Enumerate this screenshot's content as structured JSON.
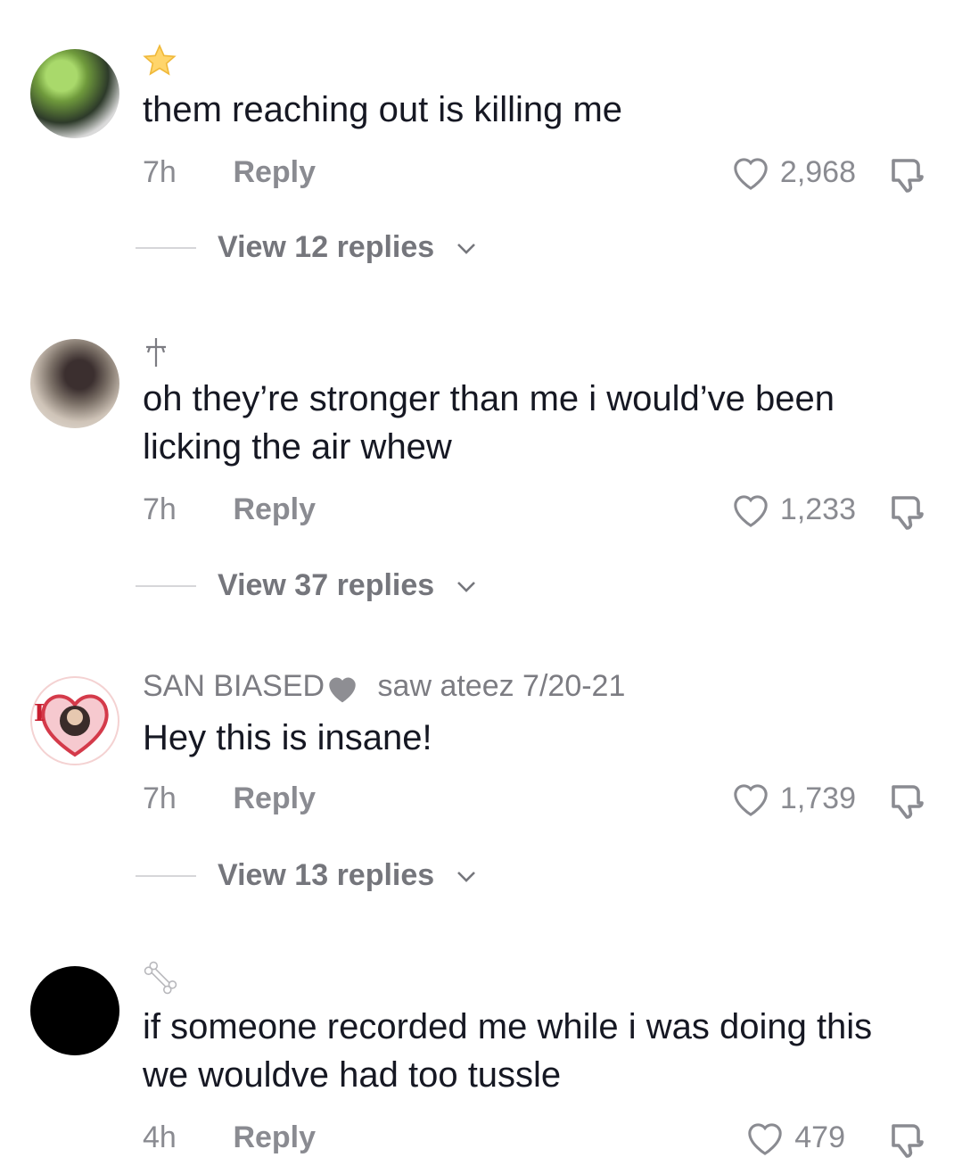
{
  "comments": [
    {
      "username": "",
      "emoji": "⭐",
      "text": "them reaching out is killing me",
      "time": "7h",
      "reply_label": "Reply",
      "likes": "2,968",
      "view_replies": "View 12 replies"
    },
    {
      "username": "",
      "emoji": "☩",
      "text": "oh they’re stronger than me i would’ve been licking the air whew",
      "time": "7h",
      "reply_label": "Reply",
      "likes": "1,233",
      "view_replies": "View 37 replies"
    },
    {
      "username": "SAN BIASED",
      "username_suffix": "saw ateez 7/20-21",
      "text": "Hey this is insane!",
      "time": "7h",
      "reply_label": "Reply",
      "likes": "1,739",
      "view_replies": "View 13 replies"
    },
    {
      "username": "",
      "emoji": "🦴",
      "text": "if someone recorded me while i was doing this we wouldve had too tussle",
      "time": "4h",
      "reply_label": "Reply",
      "likes": "479"
    }
  ],
  "icons": {
    "like": "heart-outline-icon",
    "dislike": "thumbs-down-icon",
    "expand": "chevron-down-icon"
  },
  "colors": {
    "text": "#161823",
    "secondary": "#8a8b91",
    "divider": "#d6d6d9"
  }
}
